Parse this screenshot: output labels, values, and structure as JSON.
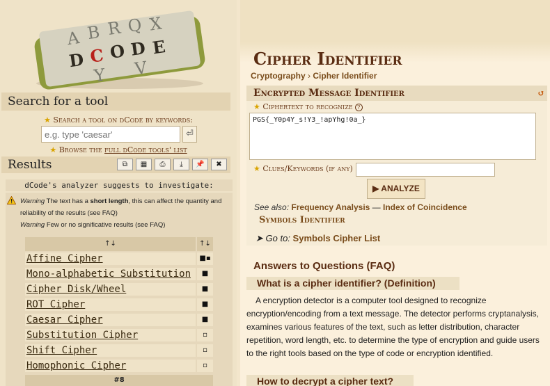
{
  "sidebar": {
    "logo_letters": [
      "D",
      "C",
      "O",
      "D",
      "E",
      "A",
      "B",
      "R",
      "Q",
      "X",
      "Y",
      "V"
    ],
    "search_heading": "Search for a tool",
    "search_label": "Search a tool on dCode by keywords:",
    "search_placeholder": "e.g. type 'caesar'",
    "search_go": "⏎",
    "browse_prefix": "Browse the",
    "browse_link": "full dCode tools' list",
    "results_heading": "Results",
    "result_tools": [
      "⧉",
      "▦",
      "⎙",
      "⤓",
      "📌",
      "✖"
    ],
    "suggest": "dCode's analyzer suggests to investigate:",
    "warning_word": "Warning",
    "warning1_a": " The text has a ",
    "warning1_b": "short length",
    "warning1_c": ", this can affect the quantity and reliability of the results (see FAQ)",
    "warning2": " Few or no significative results (see FAQ)",
    "col_name": "↑↓",
    "col_score": "↑↓",
    "results": [
      {
        "name": "Affine Cipher",
        "score": "■▪"
      },
      {
        "name": "Mono-alphabetic Substitution",
        "score": "■"
      },
      {
        "name": "Cipher Disk/Wheel",
        "score": "■"
      },
      {
        "name": "ROT Cipher",
        "score": "■"
      },
      {
        "name": "Caesar Cipher",
        "score": "■"
      },
      {
        "name": "Substitution Cipher",
        "score": "▫"
      },
      {
        "name": "Shift Cipher",
        "score": "▫"
      },
      {
        "name": "Homophonic Cipher",
        "score": "▫"
      }
    ],
    "more": "#8"
  },
  "main": {
    "title": "Cipher Identifier",
    "breadcrumb": [
      "Cryptography",
      "Cipher Identifier"
    ],
    "tool_heading": "Encrypted Message Identifier",
    "refresh": "↺",
    "ciphertext_label": "Ciphertext to recognize",
    "help": "?",
    "ciphertext_value": "PGS{_Y0p4Y_s!Y3_!apYhg!0a_}",
    "clues_label": "Clues/Keywords (if any)",
    "analyze_label": "▶ ANALYZE",
    "see_also": "See also:",
    "see_link1": "Frequency Analysis",
    "see_dash": " — ",
    "see_link2": "Index of Coincidence",
    "symbols_heading": "Symbols Identifier",
    "goto_prefix": "➤ Go to:",
    "goto_link": "Symbols Cipher List",
    "faq_heading": "Answers to Questions (FAQ)",
    "q1": "What is a cipher identifier? (Definition)",
    "a1": "A encryption detector is a computer tool designed to recognize encryption/encoding from a text message. The detector performs cryptanalysis, examines various features of the text, such as letter distribution, character repetition, word length, etc. to determine the type of encryption and guide users to the right tools based on the type of code or encryption identified.",
    "q2": "How to decrypt a cipher text?"
  },
  "colors": {
    "accent": "#5a2c12",
    "link": "#7a4d1c",
    "star": "#d9a400"
  }
}
